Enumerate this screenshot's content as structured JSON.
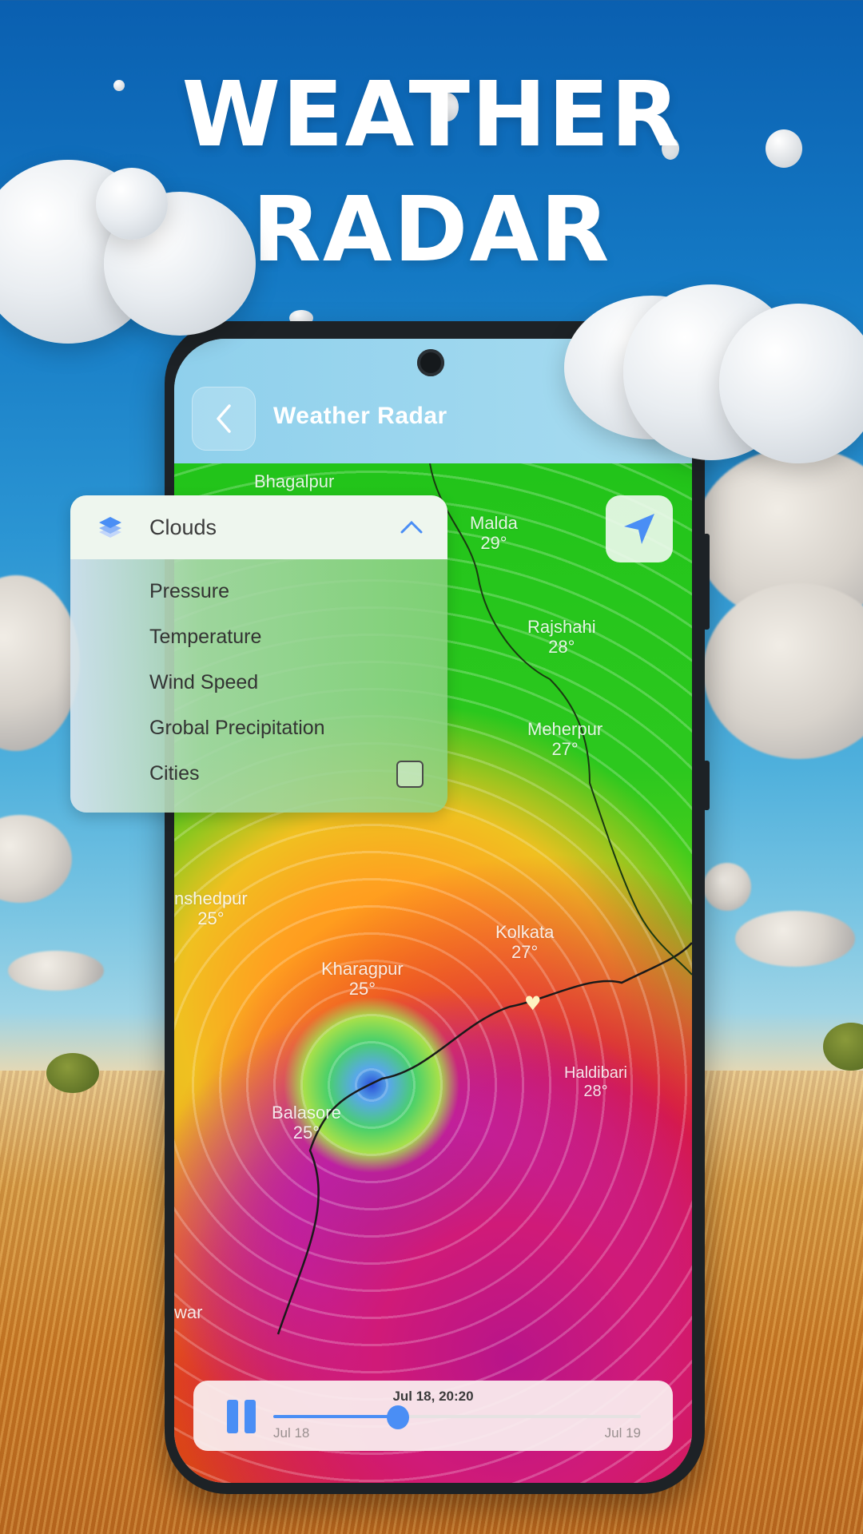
{
  "promo": {
    "headline_line1": "WEATHER",
    "headline_line2": "RADAR"
  },
  "app": {
    "title": "Weather Radar",
    "back_icon": "chevron-left-icon",
    "locate_icon": "navigation-arrow-icon"
  },
  "layers": {
    "selected": "Clouds",
    "selected_icon": "layers-icon",
    "expand_icon": "chevron-up-icon",
    "options": [
      {
        "label": "Pressure"
      },
      {
        "label": "Temperature"
      },
      {
        "label": "Wind Speed"
      },
      {
        "label": "Grobal Precipitation"
      },
      {
        "label": "Cities",
        "checkbox": true,
        "checked": false
      }
    ]
  },
  "map": {
    "cities": [
      {
        "name": "Bhagalpur",
        "temp": ""
      },
      {
        "name": "Malda",
        "temp": "29°"
      },
      {
        "name": "Rajshahi",
        "temp": "28°"
      },
      {
        "name": "Meherpur",
        "temp": "27°"
      },
      {
        "name": "nshedpur",
        "temp": "25°"
      },
      {
        "name": "Kolkata",
        "temp": "27°"
      },
      {
        "name": "Kharagpur",
        "temp": "25°"
      },
      {
        "name": "Balasore",
        "temp": "25°"
      },
      {
        "name": "Haldibari",
        "temp": "28°"
      },
      {
        "name": "war",
        "temp": ""
      }
    ]
  },
  "player": {
    "state": "playing",
    "current_time": "Jul 18, 20:20",
    "start_label": "Jul 18",
    "end_label": "Jul 19",
    "progress": 0.34,
    "accent": "#4a8ef5"
  }
}
